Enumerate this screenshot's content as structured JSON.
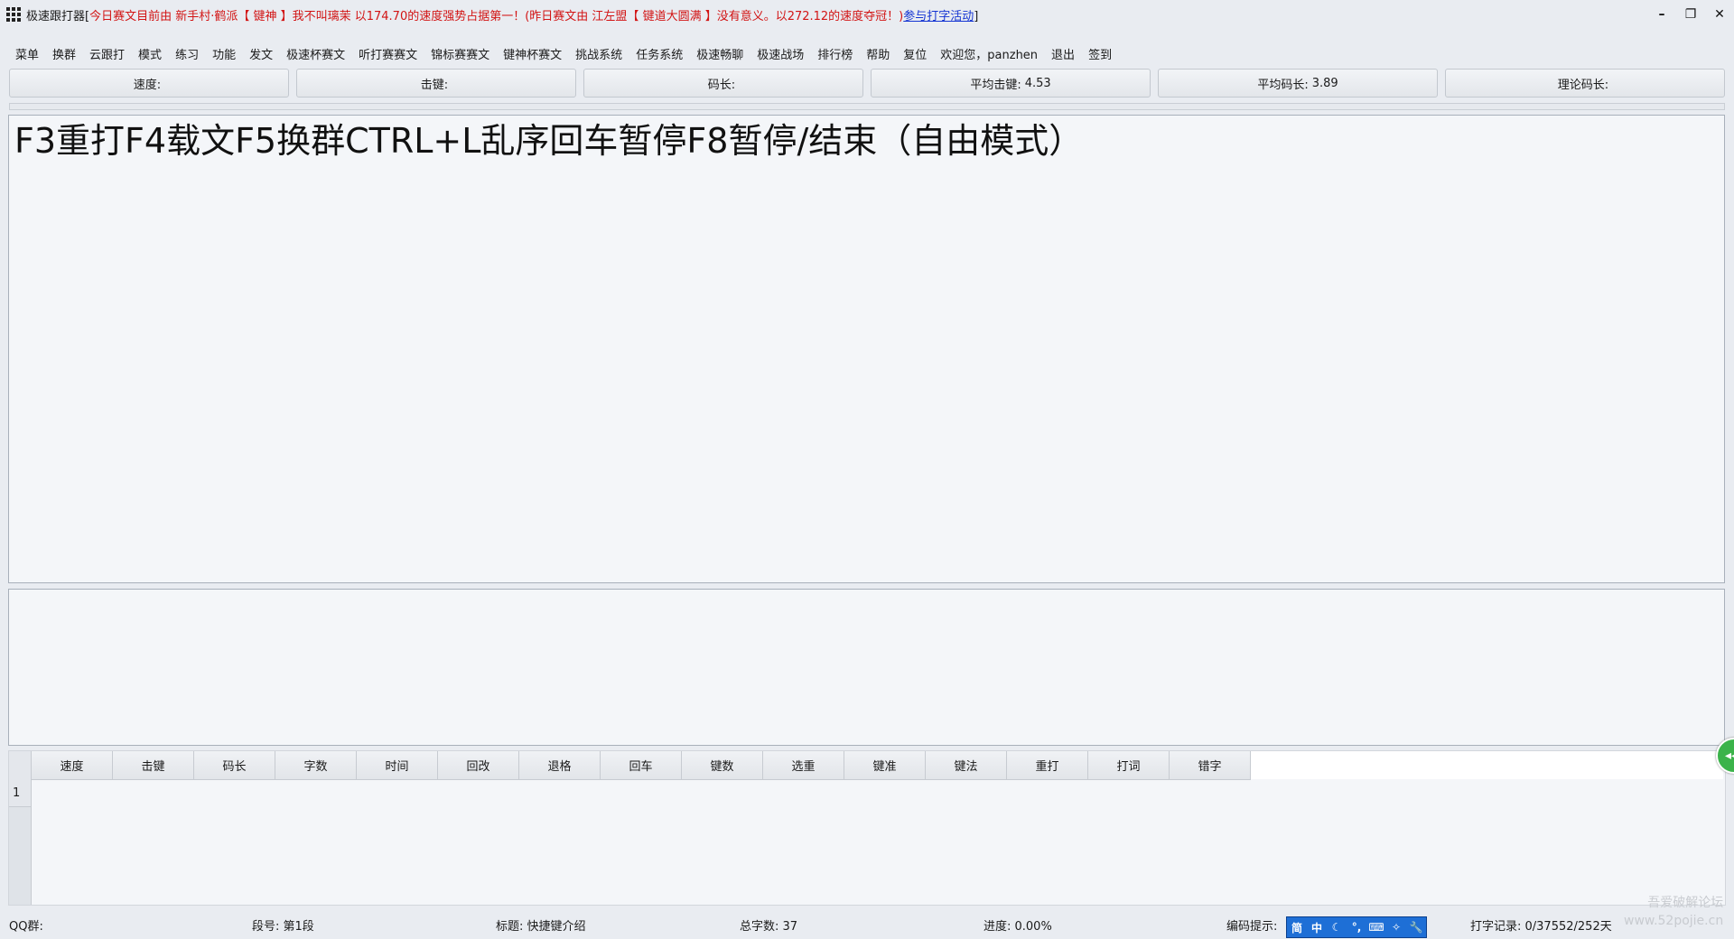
{
  "window": {
    "app_title": "极速跟打器[",
    "marquee": "今日赛文目前由 新手村·鹤派【 键神 】我不叫璃茉 以174.70的速度强势占据第一！(昨日赛文由 江左盟【 键道大圆满 】没有意义。以272.12的速度夺冠！)",
    "link": "参与打字活动",
    "title_end": "]",
    "controls": {
      "minimize": "–",
      "restore": "❐",
      "close": "✕"
    }
  },
  "menu": [
    "菜单",
    "换群",
    "云跟打",
    "模式",
    "练习",
    "功能",
    "发文",
    "极速杯赛文",
    "听打赛赛文",
    "锦标赛赛文",
    "键神杯赛文",
    "挑战系统",
    "任务系统",
    "极速畅聊",
    "极速战场",
    "排行榜",
    "帮助",
    "复位",
    "欢迎您，panzhen",
    "退出",
    "签到"
  ],
  "stats": [
    {
      "label": "速度:",
      "value": ""
    },
    {
      "label": "击键:",
      "value": ""
    },
    {
      "label": "码长:",
      "value": ""
    },
    {
      "label": "平均击键:",
      "value": "4.53"
    },
    {
      "label": "平均码长:",
      "value": "3.89"
    },
    {
      "label": "理论码长:",
      "value": ""
    }
  ],
  "text_area": {
    "content": "F3重打F4载文F5换群CTRL+L乱序回车暂停F8暂停/结束（自由模式）"
  },
  "table": {
    "columns": [
      "速度",
      "击键",
      "码长",
      "字数",
      "时间",
      "回改",
      "退格",
      "回车",
      "键数",
      "选重",
      "键准",
      "键法",
      "重打",
      "打词",
      "错字"
    ],
    "row_numbers": [
      "1"
    ]
  },
  "side_button": {
    "label": "◂◂"
  },
  "status": {
    "qq": "QQ群:",
    "segment": "段号: 第1段",
    "title": "标题: 快捷键介绍",
    "total": "总字数: 37",
    "progress": "进度: 0.00%",
    "hint": "编码提示:",
    "record": "打字记录: 0/37552/252天"
  },
  "ime": [
    "简",
    "中",
    "☾",
    "°,",
    "⌨",
    "✧",
    "🔧"
  ],
  "watermark": {
    "line1": "吾爱破解论坛",
    "line2": "www.52pojie.cn"
  }
}
